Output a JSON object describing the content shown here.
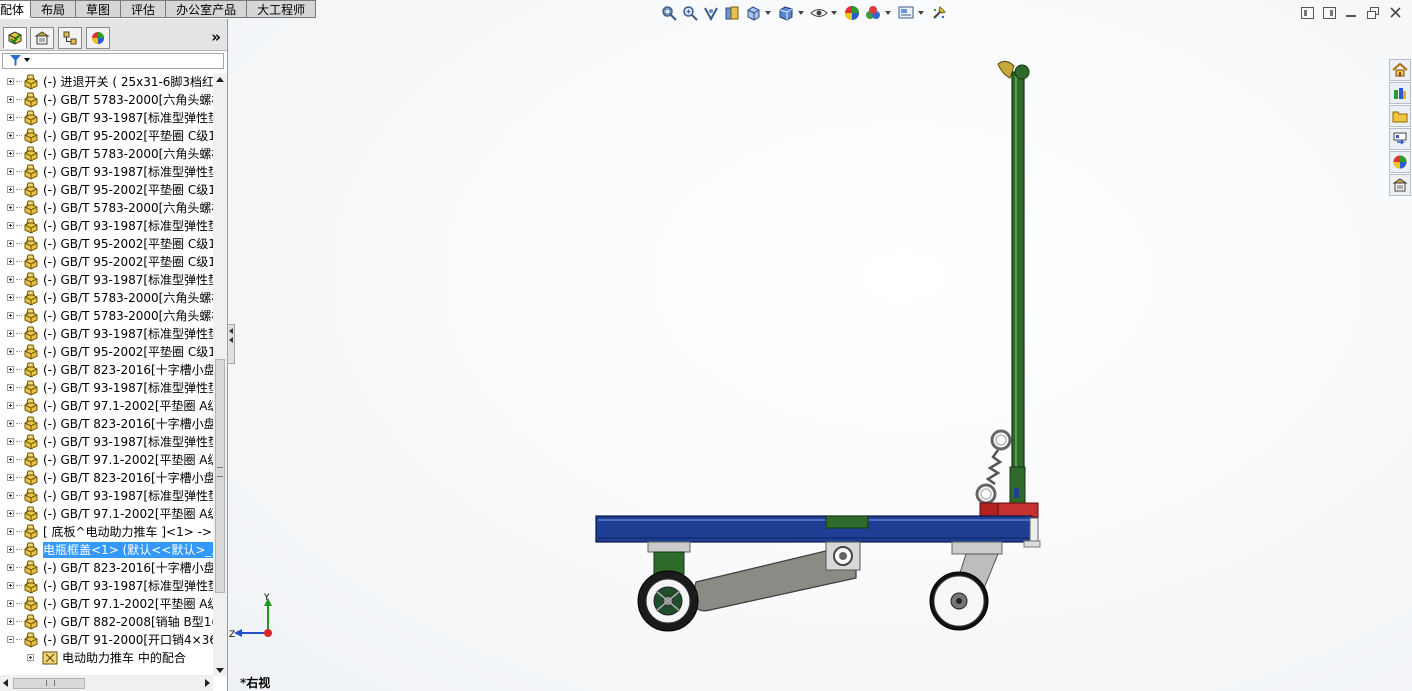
{
  "command_tabs": [
    {
      "label": "配体",
      "active": true
    },
    {
      "label": "布局",
      "active": false
    },
    {
      "label": "草图",
      "active": false
    },
    {
      "label": "评估",
      "active": false
    },
    {
      "label": "办公室产品",
      "active": false
    },
    {
      "label": "大工程师",
      "active": false
    }
  ],
  "panel_tabs": [
    {
      "icon": "feature-manager-icon",
      "active": true
    },
    {
      "icon": "property-manager-icon",
      "active": false
    },
    {
      "icon": "configuration-manager-icon",
      "active": false
    },
    {
      "icon": "display-manager-icon",
      "active": false
    }
  ],
  "panel_more": "»",
  "feature_tree": [
    {
      "label": "(-) 进退开关 ( 25x31-6脚3档红(",
      "icon": "part-icon"
    },
    {
      "label": "(-) GB/T 5783-2000[六角头螺栓",
      "icon": "part-icon"
    },
    {
      "label": "(-) GB/T 93-1987[标准型弹性垫",
      "icon": "part-icon"
    },
    {
      "label": "(-) GB/T 95-2002[平垫圈 C级1",
      "icon": "part-icon"
    },
    {
      "label": "(-) GB/T 5783-2000[六角头螺栓",
      "icon": "part-icon"
    },
    {
      "label": "(-) GB/T 93-1987[标准型弹性垫",
      "icon": "part-icon"
    },
    {
      "label": "(-) GB/T 95-2002[平垫圈 C级1",
      "icon": "part-icon"
    },
    {
      "label": "(-) GB/T 5783-2000[六角头螺栓",
      "icon": "part-icon"
    },
    {
      "label": "(-) GB/T 93-1987[标准型弹性垫",
      "icon": "part-icon"
    },
    {
      "label": "(-) GB/T 95-2002[平垫圈 C级1",
      "icon": "part-icon"
    },
    {
      "label": "(-) GB/T 95-2002[平垫圈 C级1",
      "icon": "part-icon"
    },
    {
      "label": "(-) GB/T 93-1987[标准型弹性垫",
      "icon": "part-icon"
    },
    {
      "label": "(-) GB/T 5783-2000[六角头螺栓",
      "icon": "part-icon"
    },
    {
      "label": "(-) GB/T 5783-2000[六角头螺栓",
      "icon": "part-icon"
    },
    {
      "label": "(-) GB/T 93-1987[标准型弹性垫",
      "icon": "part-icon"
    },
    {
      "label": "(-) GB/T 95-2002[平垫圈 C级1",
      "icon": "part-icon"
    },
    {
      "label": "(-) GB/T 823-2016[十字槽小盘",
      "icon": "part-icon"
    },
    {
      "label": "(-) GB/T 93-1987[标准型弹性垫",
      "icon": "part-icon"
    },
    {
      "label": "(-) GB/T 97.1-2002[平垫圈 A级",
      "icon": "part-icon"
    },
    {
      "label": "(-) GB/T 823-2016[十字槽小盘",
      "icon": "part-icon"
    },
    {
      "label": "(-) GB/T 93-1987[标准型弹性垫",
      "icon": "part-icon"
    },
    {
      "label": "(-) GB/T 97.1-2002[平垫圈 A级",
      "icon": "part-icon"
    },
    {
      "label": "(-) GB/T 823-2016[十字槽小盘",
      "icon": "part-icon"
    },
    {
      "label": "(-) GB/T 93-1987[标准型弹性垫",
      "icon": "part-icon"
    },
    {
      "label": "(-) GB/T 97.1-2002[平垫圈 A级",
      "icon": "part-icon"
    },
    {
      "label": "[ 底板^电动助力推车 ]<1> ->",
      "icon": "part-icon"
    },
    {
      "label": "电瓶框盖<1> (默认<<默认>_显",
      "icon": "part-icon",
      "selected": true
    },
    {
      "label": "(-) GB/T 823-2016[十字槽小盘",
      "icon": "part-icon"
    },
    {
      "label": "(-) GB/T 93-1987[标准型弹性垫",
      "icon": "part-icon"
    },
    {
      "label": "(-) GB/T 97.1-2002[平垫圈 A级",
      "icon": "part-icon"
    },
    {
      "label": "(-) GB/T 882-2008[销轴 B型1(",
      "icon": "part-icon"
    },
    {
      "label": "(-) GB/T 91-2000[开口销4×36",
      "icon": "part-icon",
      "expanded": true
    },
    {
      "label": "电动助力推车 中的配合",
      "icon": "mates-icon",
      "sub": true
    }
  ],
  "heads_up_toolbar": [
    "zoom-to-fit-icon",
    "zoom-to-area-icon",
    "previous-view-icon",
    "section-view-icon",
    "view-orientation-icon",
    "display-style-icon",
    "hide-show-items-icon",
    "edit-appearance-icon",
    "apply-scene-icon",
    "view-settings-icon",
    "rotate-icon"
  ],
  "window_controls": [
    "tile-horizontal-icon",
    "tile-vertical-icon",
    "minimize-icon",
    "restore-icon",
    "close-icon"
  ],
  "task_pane": [
    "home-icon",
    "design-library-icon",
    "file-explorer-icon",
    "view-palette-icon",
    "appearances-icon",
    "custom-properties-icon"
  ],
  "triad": {
    "y_label": "Y",
    "z_label": "Z"
  },
  "view_label": "*右视",
  "colors": {
    "selection": "#3399ff",
    "frame_blue": "#1f3f95",
    "handle_green": "#2e6b2a",
    "link_gray": "#8c8a85",
    "bracket_red": "#b22222"
  }
}
